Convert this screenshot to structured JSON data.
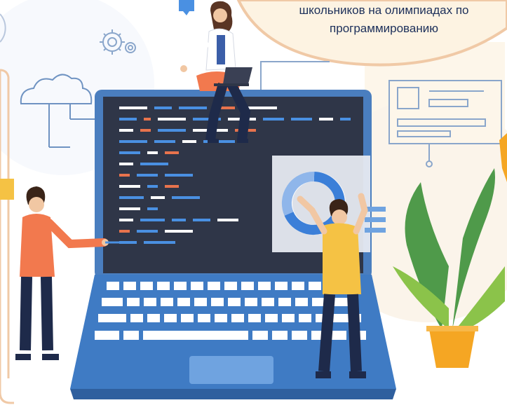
{
  "caption": {
    "line_1": "школьников на олимпиадах по",
    "line_2": "программированию"
  },
  "colors": {
    "caption_bubble": "#fdf3e2",
    "caption_border": "#f0c9a6",
    "caption_text": "#1c2f5a",
    "laptop_frame": "#4a7ebf",
    "laptop_screen": "#2f3648",
    "laptop_base": "#3f7bc4",
    "keys": "#ffffff",
    "code_blue": "#4a90e2",
    "code_orange": "#e8734d",
    "code_white": "#ffffff",
    "donut_blue": "#3b7fd8",
    "donut_light": "#e6eaf1",
    "plant_green": "#4f9a4a",
    "plant_light": "#8bc34a",
    "pot": "#f5a623",
    "person_orange_shirt": "#f2794e",
    "person_yellow_shirt": "#f5c244",
    "person_white_shirt": "#ffffff",
    "pants_navy": "#1e2a4a",
    "skin": "#f1c7a3",
    "hair_brown": "#5a3524"
  },
  "icons": [
    "cloud-icon",
    "gear-icon",
    "chat-bubble-icon",
    "document-card-icon",
    "donut-chart-icon",
    "plant-icon"
  ]
}
